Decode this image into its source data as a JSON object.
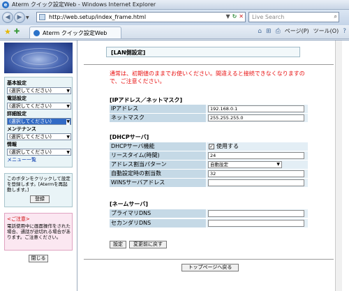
{
  "window": {
    "title": "Aterm クイック設定Web - Windows Internet Explorer"
  },
  "browser": {
    "address": "http://web.setup/index_frame.html",
    "search_placeholder": "Live Search",
    "tab_title": "Aterm クイック設定Web",
    "page_menu": "ページ(P)",
    "tools_menu": "ツール(O)"
  },
  "sidebar": {
    "menus": [
      {
        "label": "基本設定",
        "value": "(選択してください)"
      },
      {
        "label": "電話設定",
        "value": "(選択してください)"
      },
      {
        "label": "詳細設定",
        "value": "(選択してください)"
      },
      {
        "label": "メンテナンス",
        "value": "(選択してください)"
      },
      {
        "label": "情報",
        "value": "(選択してください)"
      }
    ],
    "menu_link": "メニュー一覧",
    "apply_text": "このボタンをクリックして設定を登録します。[Atermを再起動します。]",
    "apply_button": "登録",
    "caution_title": "<ご注意>",
    "caution_text": "電話使用中に画面操作をされた場合、通話が途切れる場合があります。ご注意ください。",
    "close_button": "閉じる"
  },
  "main": {
    "title": "[LAN側設定]",
    "warning": "通常は、初期値のままでお使いください。間違えると接続できなくなりますので、ご注意ください。",
    "sections": {
      "ip": {
        "title": "[IPアドレス／ネットマスク]",
        "ip_label": "IPアドレス",
        "ip_value": "192.168.0.1",
        "mask_label": "ネットマスク",
        "mask_value": "255.255.255.0"
      },
      "dhcp": {
        "title": "[DHCPサーバ]",
        "func_label": "DHCPサーバ機能",
        "func_check": "使用する",
        "lease_label": "リースタイム(時間)",
        "lease_value": "24",
        "pattern_label": "アドレス割当パターン",
        "pattern_value": "自動設定",
        "count_label": "自動設定時の割当数",
        "count_value": "32",
        "wins_label": "WINSサーバアドレス",
        "wins_value": ""
      },
      "dns": {
        "title": "[ネームサーバ]",
        "primary_label": "プライマリDNS",
        "primary_value": "",
        "secondary_label": "セカンダリDNS",
        "secondary_value": ""
      }
    },
    "set_button": "設定",
    "revert_button": "変更前に戻す",
    "top_button": "トップページへ戻る"
  }
}
